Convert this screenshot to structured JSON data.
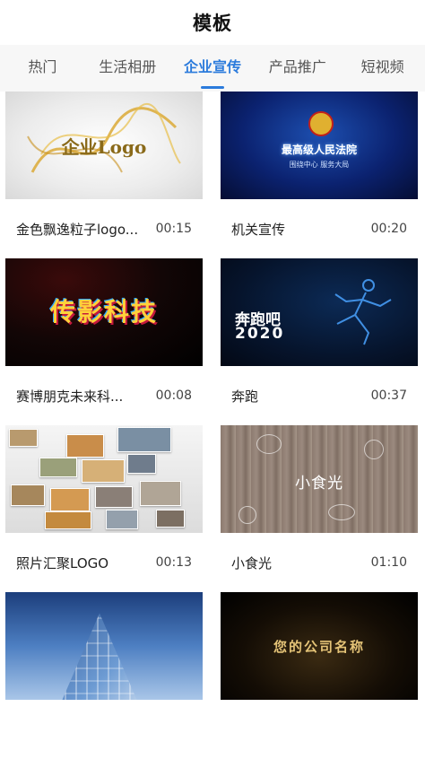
{
  "header": {
    "title": "模板"
  },
  "tabs": [
    {
      "label": "热门",
      "active": false
    },
    {
      "label": "生活相册",
      "active": false
    },
    {
      "label": "企业宣传",
      "active": true
    },
    {
      "label": "产品推广",
      "active": false
    },
    {
      "label": "短视频",
      "active": false
    }
  ],
  "templates": [
    {
      "name": "金色飘逸粒子logo...",
      "duration": "00:15",
      "thumb_text": "企业Logo"
    },
    {
      "name": "机关宣传",
      "duration": "00:20",
      "thumb_text": "最高级人民法院",
      "thumb_sub": "围绕中心 服务大局"
    },
    {
      "name": "赛博朋克未来科...",
      "duration": "00:08",
      "thumb_text": "传影科技"
    },
    {
      "name": "奔跑",
      "duration": "00:37",
      "thumb_line1": "奔跑吧",
      "thumb_line2": "2020"
    },
    {
      "name": "照片汇聚LOGO",
      "duration": "00:13"
    },
    {
      "name": "小食光",
      "duration": "01:10",
      "thumb_text": "小食光"
    },
    {
      "name": "",
      "duration": ""
    },
    {
      "name": "",
      "duration": "",
      "thumb_text": "您的公司名称"
    }
  ],
  "colors": {
    "accent": "#2b7bdc"
  }
}
